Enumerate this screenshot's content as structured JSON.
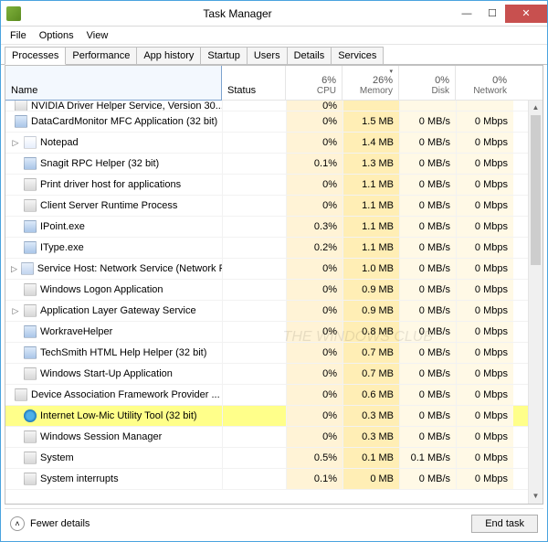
{
  "window": {
    "title": "Task Manager"
  },
  "menu": {
    "file": "File",
    "options": "Options",
    "view": "View"
  },
  "tabs": {
    "processes": "Processes",
    "performance": "Performance",
    "apphistory": "App history",
    "startup": "Startup",
    "users": "Users",
    "details": "Details",
    "services": "Services"
  },
  "columns": {
    "name": "Name",
    "status": "Status",
    "cpu_pct": "6%",
    "cpu": "CPU",
    "mem_pct": "26%",
    "mem": "Memory",
    "disk_pct": "0%",
    "disk": "Disk",
    "net_pct": "0%",
    "net": "Network"
  },
  "footer": {
    "fewer": "Fewer details",
    "endtask": "End task"
  },
  "watermark": "THE WINDOWS CLUB",
  "processes": [
    {
      "exp": "",
      "icon": "sys",
      "name": "NVIDIA Driver Helper Service, Version 30...",
      "cpu": "0%",
      "mem": "",
      "disk": "",
      "net": "",
      "cut": true
    },
    {
      "exp": "",
      "icon": "app",
      "name": "DataCardMonitor MFC Application (32 bit)",
      "cpu": "0%",
      "mem": "1.5 MB",
      "disk": "0 MB/s",
      "net": "0 Mbps"
    },
    {
      "exp": "▷",
      "icon": "note",
      "name": "Notepad",
      "cpu": "0%",
      "mem": "1.4 MB",
      "disk": "0 MB/s",
      "net": "0 Mbps"
    },
    {
      "exp": "",
      "icon": "app",
      "name": "Snagit RPC Helper (32 bit)",
      "cpu": "0.1%",
      "mem": "1.3 MB",
      "disk": "0 MB/s",
      "net": "0 Mbps"
    },
    {
      "exp": "",
      "icon": "sys",
      "name": "Print driver host for applications",
      "cpu": "0%",
      "mem": "1.1 MB",
      "disk": "0 MB/s",
      "net": "0 Mbps"
    },
    {
      "exp": "",
      "icon": "sys",
      "name": "Client Server Runtime Process",
      "cpu": "0%",
      "mem": "1.1 MB",
      "disk": "0 MB/s",
      "net": "0 Mbps"
    },
    {
      "exp": "",
      "icon": "app",
      "name": "IPoint.exe",
      "cpu": "0.3%",
      "mem": "1.1 MB",
      "disk": "0 MB/s",
      "net": "0 Mbps"
    },
    {
      "exp": "",
      "icon": "app",
      "name": "IType.exe",
      "cpu": "0.2%",
      "mem": "1.1 MB",
      "disk": "0 MB/s",
      "net": "0 Mbps"
    },
    {
      "exp": "▷",
      "icon": "gear",
      "name": "Service Host: Network Service (Network R...",
      "cpu": "0%",
      "mem": "1.0 MB",
      "disk": "0 MB/s",
      "net": "0 Mbps"
    },
    {
      "exp": "",
      "icon": "sys",
      "name": "Windows Logon Application",
      "cpu": "0%",
      "mem": "0.9 MB",
      "disk": "0 MB/s",
      "net": "0 Mbps"
    },
    {
      "exp": "▷",
      "icon": "sys",
      "name": "Application Layer Gateway Service",
      "cpu": "0%",
      "mem": "0.9 MB",
      "disk": "0 MB/s",
      "net": "0 Mbps"
    },
    {
      "exp": "",
      "icon": "app",
      "name": "WorkraveHelper",
      "cpu": "0%",
      "mem": "0.8 MB",
      "disk": "0 MB/s",
      "net": "0 Mbps"
    },
    {
      "exp": "",
      "icon": "app",
      "name": "TechSmith HTML Help Helper (32 bit)",
      "cpu": "0%",
      "mem": "0.7 MB",
      "disk": "0 MB/s",
      "net": "0 Mbps"
    },
    {
      "exp": "",
      "icon": "sys",
      "name": "Windows Start-Up Application",
      "cpu": "0%",
      "mem": "0.7 MB",
      "disk": "0 MB/s",
      "net": "0 Mbps"
    },
    {
      "exp": "",
      "icon": "sys",
      "name": "Device Association Framework Provider ...",
      "cpu": "0%",
      "mem": "0.6 MB",
      "disk": "0 MB/s",
      "net": "0 Mbps"
    },
    {
      "exp": "",
      "icon": "ie",
      "name": "Internet Low-Mic Utility Tool (32 bit)",
      "cpu": "0%",
      "mem": "0.3 MB",
      "disk": "0 MB/s",
      "net": "0 Mbps",
      "hl": true
    },
    {
      "exp": "",
      "icon": "sys",
      "name": "Windows Session Manager",
      "cpu": "0%",
      "mem": "0.3 MB",
      "disk": "0 MB/s",
      "net": "0 Mbps"
    },
    {
      "exp": "",
      "icon": "sys",
      "name": "System",
      "cpu": "0.5%",
      "mem": "0.1 MB",
      "disk": "0.1 MB/s",
      "net": "0 Mbps"
    },
    {
      "exp": "",
      "icon": "sys",
      "name": "System interrupts",
      "cpu": "0.1%",
      "mem": "0 MB",
      "disk": "0 MB/s",
      "net": "0 Mbps"
    }
  ]
}
